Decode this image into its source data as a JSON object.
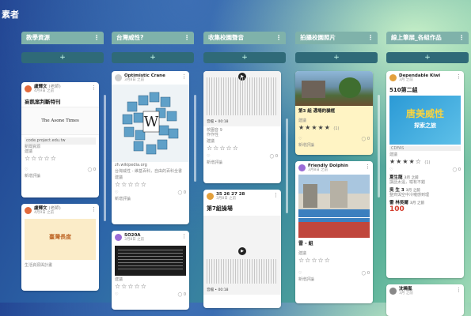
{
  "board": {
    "title": "素者"
  },
  "columns": [
    {
      "title": "教學資源",
      "add": "+",
      "cards": [
        {
          "author": "盧輝文",
          "author_tag": "(老師)",
          "time": "4月9日 之前",
          "title": "妄凱案判斷特刊",
          "image_caption": "The Asone Times",
          "link": "code.project.edu.tw",
          "meta1": "新聞資源",
          "meta2": "建議",
          "stars": "☆☆☆☆☆",
          "comments": "0",
          "comment_label": "新增評論"
        },
        {
          "author": "盧輝文",
          "author_tag": "(老師)",
          "time": "4月9日 之前",
          "image_caption": "臺灣長度",
          "meta1": "生活資源與計畫"
        }
      ]
    },
    {
      "title": "台灣威性?",
      "add": "+",
      "cards": [
        {
          "author": "Optimistic Crane",
          "time": "3月8日 之前",
          "link": "zh.wikipedia.org",
          "meta1": "台灣威性 - 維基百科，自由的百科全書",
          "meta2": "建議",
          "stars": "☆☆☆☆☆",
          "comments": "0",
          "comment_label": "新增評論"
        },
        {
          "author": "SO20A",
          "time": "3月8日 之前",
          "meta2": "建議",
          "stars": "☆☆☆☆☆",
          "comments": "0",
          "comment_label": "新增評論"
        }
      ]
    },
    {
      "title": "收集校園聲音",
      "add": "+",
      "cards": [
        {
          "play": "▶",
          "duration": "音檔 • 00:18",
          "meta1": "校園音 9",
          "meta_b": "作作性",
          "meta2": "建議",
          "stars": "☆☆☆☆☆",
          "comments": "0",
          "comment_label": "新增評論"
        },
        {
          "author": "35 26 27 28",
          "time": "3月8日 之前",
          "title": "第7組操場",
          "play": "▶",
          "duration": "音檔 • 00:18"
        }
      ]
    },
    {
      "title": "拍攝校園照片",
      "add": "+",
      "cards": [
        {
          "title": "第3 組 邁場的貓框",
          "meta2": "建議",
          "stars": "★★★★★",
          "rating_count": "(1)",
          "comments": "0",
          "comment_label": "新增評論"
        },
        {
          "author": "Friendly Dolphin",
          "time": "3月8日 之前",
          "title": "雷 - 組",
          "meta2": "建議",
          "stars": "☆☆☆☆☆",
          "comments": "0",
          "comment_label": "新增評論"
        }
      ]
    },
    {
      "title": "線上筆展_各組作品",
      "add": "+",
      "cards": [
        {
          "author": "Dependable Kiwi",
          "time": "3月 之前",
          "title": "510第二組",
          "banner_text": "唐美威性",
          "banner_sub": "探索之旅",
          "file_tag": "CDFAS",
          "meta2": "建議",
          "stars": "★★★★☆",
          "rating_count": "(1)",
          "comments": "0",
          "comment_label": "新增評論",
          "replies": [
            {
              "name": "夏生龍",
              "time": "3月 之前",
              "text": "講話太遠，喻有不錯"
            },
            {
              "name": "吳 生 3",
              "time": "3月 之前",
              "text": "整齊與空中冷嚨感到理"
            },
            {
              "name": "雷 林吳爾",
              "time": "3月 之前",
              "text": "100"
            }
          ]
        },
        {
          "author": "沈曉嵐",
          "time": "3月 之前"
        }
      ]
    }
  ],
  "colors": {
    "header": "#7fb2aa",
    "add_button": "#2f6a78",
    "card_bg": "#ffffff",
    "note_yellow": "#fff4c4"
  }
}
